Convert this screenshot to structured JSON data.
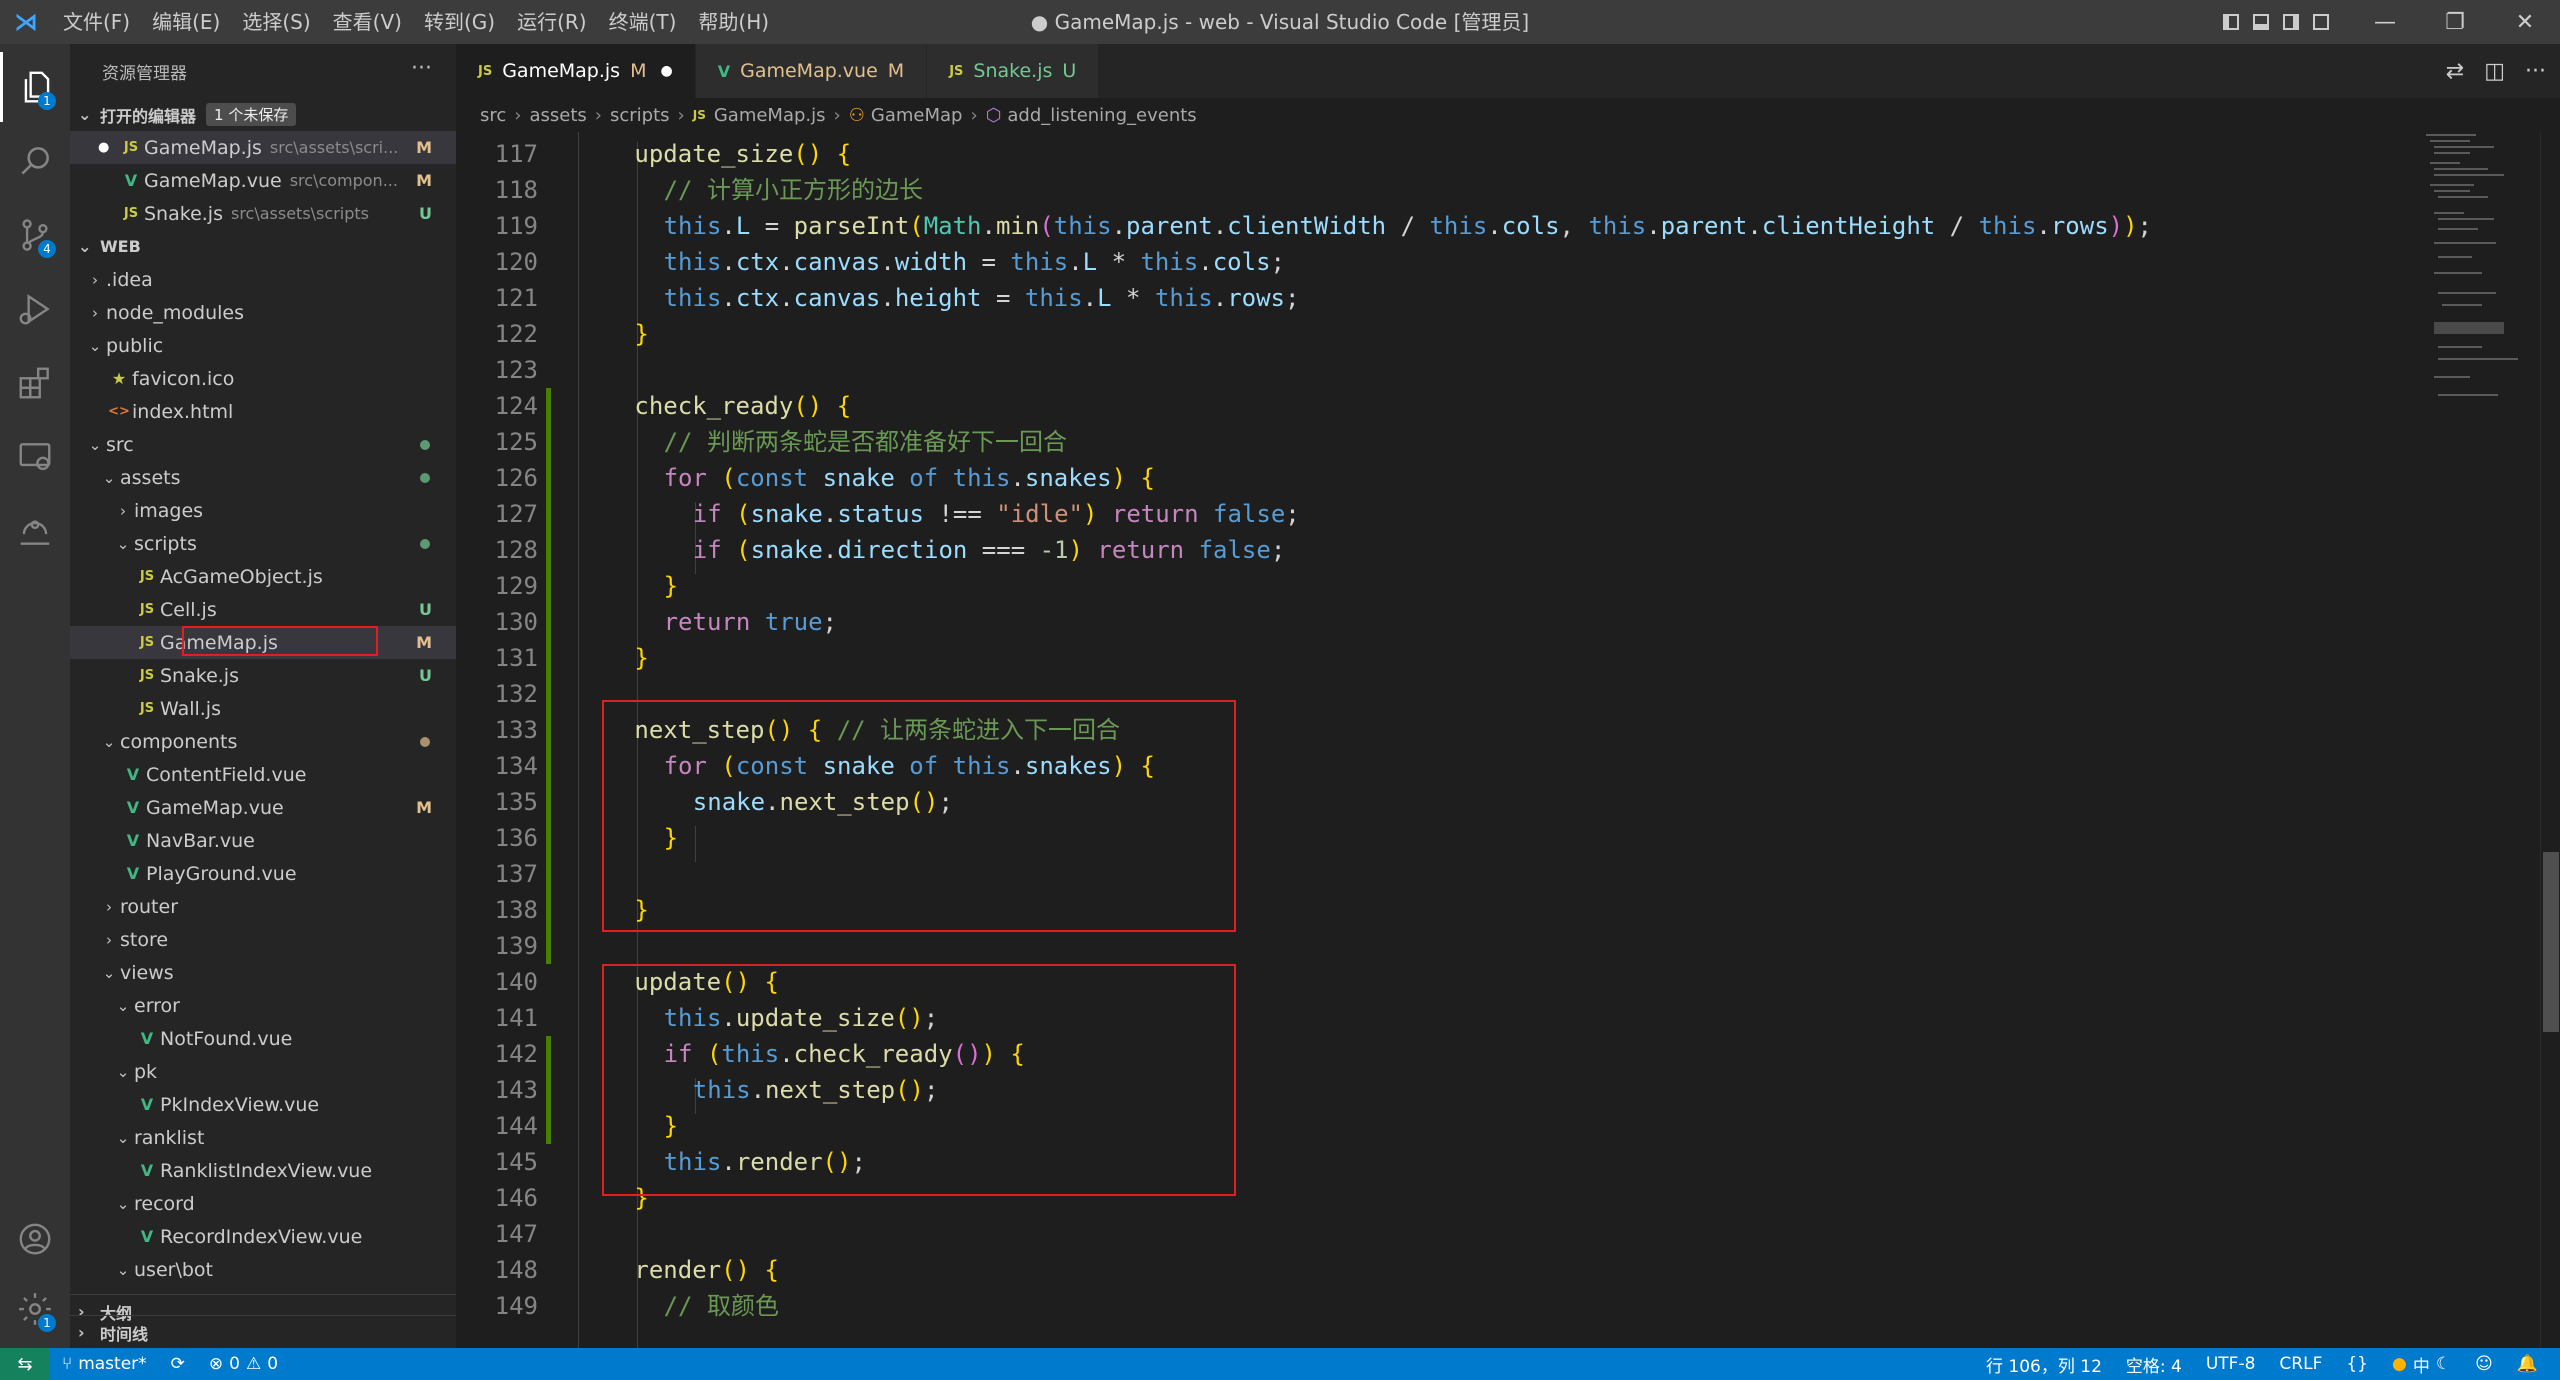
{
  "window": {
    "menu": [
      "文件(F)",
      "编辑(E)",
      "选择(S)",
      "查看(V)",
      "转到(G)",
      "运行(R)",
      "终端(T)",
      "帮助(H)"
    ],
    "title": "● GameMap.js - web - Visual Studio Code [管理员]"
  },
  "activity_bar": {
    "explorer_badge": "1",
    "scm_badge": "4",
    "settings_badge": "1"
  },
  "sidebar": {
    "title": "资源管理器",
    "more": "···",
    "open_editors": {
      "label": "打开的编辑器",
      "dirty": "1 个未保存",
      "items": [
        {
          "icon": "JS",
          "name": "GameMap.js",
          "path": "src\\assets\\scri...",
          "status": "M"
        },
        {
          "icon": "V",
          "name": "GameMap.vue",
          "path": "src\\compon...",
          "status": "M"
        },
        {
          "icon": "JS",
          "name": "Snake.js",
          "path": "src\\assets\\scripts",
          "status": "U"
        }
      ]
    },
    "workspace": "WEB",
    "tree": [
      {
        "name": ".idea",
        "chev": "›",
        "icon": "",
        "status": ""
      },
      {
        "name": "node_modules",
        "chev": "›",
        "icon": "",
        "status": ""
      },
      {
        "name": "public",
        "chev": "⌄",
        "icon": "",
        "status": ""
      },
      {
        "name": "favicon.ico",
        "chev": "",
        "icon": "★",
        "status": ""
      },
      {
        "name": "index.html",
        "chev": "",
        "icon": "<>",
        "status": ""
      },
      {
        "name": "src",
        "chev": "⌄",
        "icon": "",
        "status": ""
      },
      {
        "name": "assets",
        "chev": "⌄",
        "icon": "",
        "status": ""
      },
      {
        "name": "images",
        "chev": "›",
        "icon": "",
        "status": ""
      },
      {
        "name": "scripts",
        "chev": "⌄",
        "icon": "",
        "status": ""
      },
      {
        "name": "AcGameObject.js",
        "chev": "",
        "icon": "JS",
        "status": ""
      },
      {
        "name": "Cell.js",
        "chev": "",
        "icon": "JS",
        "status": "U"
      },
      {
        "name": "GameMap.js",
        "chev": "",
        "icon": "JS",
        "status": "M"
      },
      {
        "name": "Snake.js",
        "chev": "",
        "icon": "JS",
        "status": "U"
      },
      {
        "name": "Wall.js",
        "chev": "",
        "icon": "JS",
        "status": ""
      },
      {
        "name": "components",
        "chev": "⌄",
        "icon": "",
        "status": ""
      },
      {
        "name": "ContentField.vue",
        "chev": "",
        "icon": "V",
        "status": ""
      },
      {
        "name": "GameMap.vue",
        "chev": "",
        "icon": "V",
        "status": "M"
      },
      {
        "name": "NavBar.vue",
        "chev": "",
        "icon": "V",
        "status": ""
      },
      {
        "name": "PlayGround.vue",
        "chev": "",
        "icon": "V",
        "status": ""
      },
      {
        "name": "router",
        "chev": "›",
        "icon": "",
        "status": ""
      },
      {
        "name": "store",
        "chev": "›",
        "icon": "",
        "status": ""
      },
      {
        "name": "views",
        "chev": "⌄",
        "icon": "",
        "status": ""
      },
      {
        "name": "error",
        "chev": "⌄",
        "icon": "",
        "status": ""
      },
      {
        "name": "NotFound.vue",
        "chev": "",
        "icon": "V",
        "status": ""
      },
      {
        "name": "pk",
        "chev": "⌄",
        "icon": "",
        "status": ""
      },
      {
        "name": "PkIndexView.vue",
        "chev": "",
        "icon": "V",
        "status": ""
      },
      {
        "name": "ranklist",
        "chev": "⌄",
        "icon": "",
        "status": ""
      },
      {
        "name": "RanklistIndexView.vue",
        "chev": "",
        "icon": "V",
        "status": ""
      },
      {
        "name": "record",
        "chev": "⌄",
        "icon": "",
        "status": ""
      },
      {
        "name": "RecordIndexView.vue",
        "chev": "",
        "icon": "V",
        "status": ""
      },
      {
        "name": "user\\bot",
        "chev": "⌄",
        "icon": "",
        "status": ""
      }
    ],
    "outline": "大纲",
    "timeline": "时间线"
  },
  "tabs": [
    {
      "icon": "JS",
      "name": "GameMap.js",
      "flag": "M",
      "close": "●"
    },
    {
      "icon": "V",
      "name": "GameMap.vue",
      "flag": "M",
      "close": ""
    },
    {
      "icon": "JS",
      "name": "Snake.js",
      "flag": "U",
      "close": ""
    }
  ],
  "breadcrumb": {
    "parts": [
      "src",
      "assets",
      "scripts"
    ],
    "file_icon": "JS",
    "file": "GameMap.js",
    "class_icon": "⚇",
    "class": "GameMap",
    "method_icon": "⬡",
    "method": "add_listening_events"
  },
  "editor": {
    "lines": [
      {
        "no": "117",
        "code": "update_size() {"
      },
      {
        "no": "118",
        "code": "// 计算小正方形的边长"
      },
      {
        "no": "119",
        "code": "this.L = parseInt(Math.min(this.parent.clientWidth / this.cols, this.parent.clientHeight / this.rows));"
      },
      {
        "no": "120",
        "code": "this.ctx.canvas.width = this.L * this.cols;"
      },
      {
        "no": "121",
        "code": "this.ctx.canvas.height = this.L * this.rows;"
      },
      {
        "no": "122",
        "code": "}"
      },
      {
        "no": "123",
        "code": ""
      },
      {
        "no": "124",
        "code": "check_ready() {"
      },
      {
        "no": "125",
        "code": "// 判断两条蛇是否都准备好下一回合"
      },
      {
        "no": "126",
        "code": "for (const snake of this.snakes) {"
      },
      {
        "no": "127",
        "code": "if (snake.status !== \"idle\") return false;"
      },
      {
        "no": "128",
        "code": "if (snake.direction === -1) return false;"
      },
      {
        "no": "129",
        "code": "}"
      },
      {
        "no": "130",
        "code": "return true;"
      },
      {
        "no": "131",
        "code": "}"
      },
      {
        "no": "132",
        "code": ""
      },
      {
        "no": "133",
        "code": "next_step() { // 让两条蛇进入下一回合"
      },
      {
        "no": "134",
        "code": "for (const snake of this.snakes) {"
      },
      {
        "no": "135",
        "code": "snake.next_step();"
      },
      {
        "no": "136",
        "code": "}"
      },
      {
        "no": "137",
        "code": ""
      },
      {
        "no": "138",
        "code": "}"
      },
      {
        "no": "139",
        "code": ""
      },
      {
        "no": "140",
        "code": "update() {"
      },
      {
        "no": "141",
        "code": "this.update_size();"
      },
      {
        "no": "142",
        "code": "if (this.check_ready()) {"
      },
      {
        "no": "143",
        "code": "this.next_step();"
      },
      {
        "no": "144",
        "code": "}"
      },
      {
        "no": "145",
        "code": "this.render();"
      },
      {
        "no": "146",
        "code": "}"
      },
      {
        "no": "147",
        "code": ""
      },
      {
        "no": "148",
        "code": "render() {"
      },
      {
        "no": "149",
        "code": "// 取颜色"
      }
    ]
  },
  "statusbar": {
    "remote": "⇆",
    "branch": "master*",
    "sync": "⟳",
    "errors": "0",
    "warnings": "0",
    "position": "行 106，列 12",
    "spaces": "空格: 4",
    "encoding": "UTF-8",
    "eol": "CRLF",
    "language": "{}",
    "ime": "中"
  }
}
